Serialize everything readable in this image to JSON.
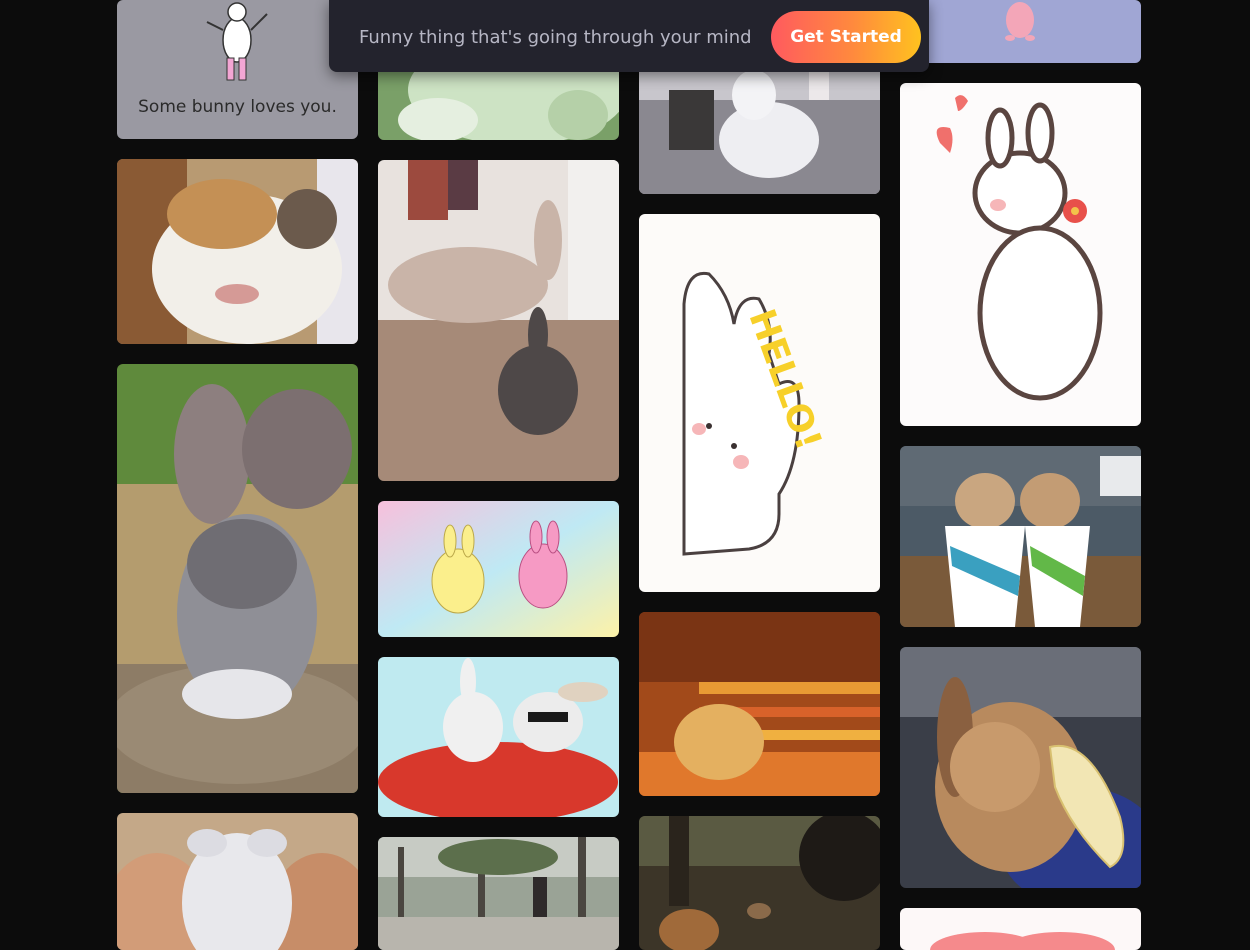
{
  "topbar": {
    "prompt_text": "Funny thing that's going through your mind",
    "cta_label": "Get Started",
    "cta_gradient": [
      "#ff5a5f",
      "#ff8a3d",
      "#ffc21f"
    ]
  },
  "gallery": {
    "column_1": [
      {
        "subject": "cartoon-bunny-loves-you",
        "caption": "Some bunny loves you."
      },
      {
        "subject": "calico-rabbit-closeup"
      },
      {
        "subject": "fluffy-grey-angora-rabbit"
      },
      {
        "subject": "baby-rabbit-in-hands"
      }
    ],
    "column_2": [
      {
        "subject": "white-rabbit-on-grass"
      },
      {
        "subject": "rabbits-jumping-indoors"
      },
      {
        "subject": "pastel-cartoon-bunnies"
      },
      {
        "subject": "bunnies-in-red-car"
      },
      {
        "subject": "rabbits-in-park"
      }
    ],
    "column_3": [
      {
        "subject": "rabbit-at-computer-desk"
      },
      {
        "subject": "bunnies-hello-sticker",
        "caption": "HELLO!"
      },
      {
        "subject": "rabbit-rolling-on-striped-blanket"
      },
      {
        "subject": "rabbits-in-forest"
      }
    ],
    "column_4": [
      {
        "subject": "pink-cartoon-bunny"
      },
      {
        "subject": "bunny-holding-flower-sticker"
      },
      {
        "subject": "rabbits-in-paper-cups"
      },
      {
        "subject": "rabbit-eating-banana"
      },
      {
        "subject": "pink-heart"
      }
    ]
  },
  "colors": {
    "background": "#0c0c0c",
    "topbar_background": "#23232d"
  }
}
